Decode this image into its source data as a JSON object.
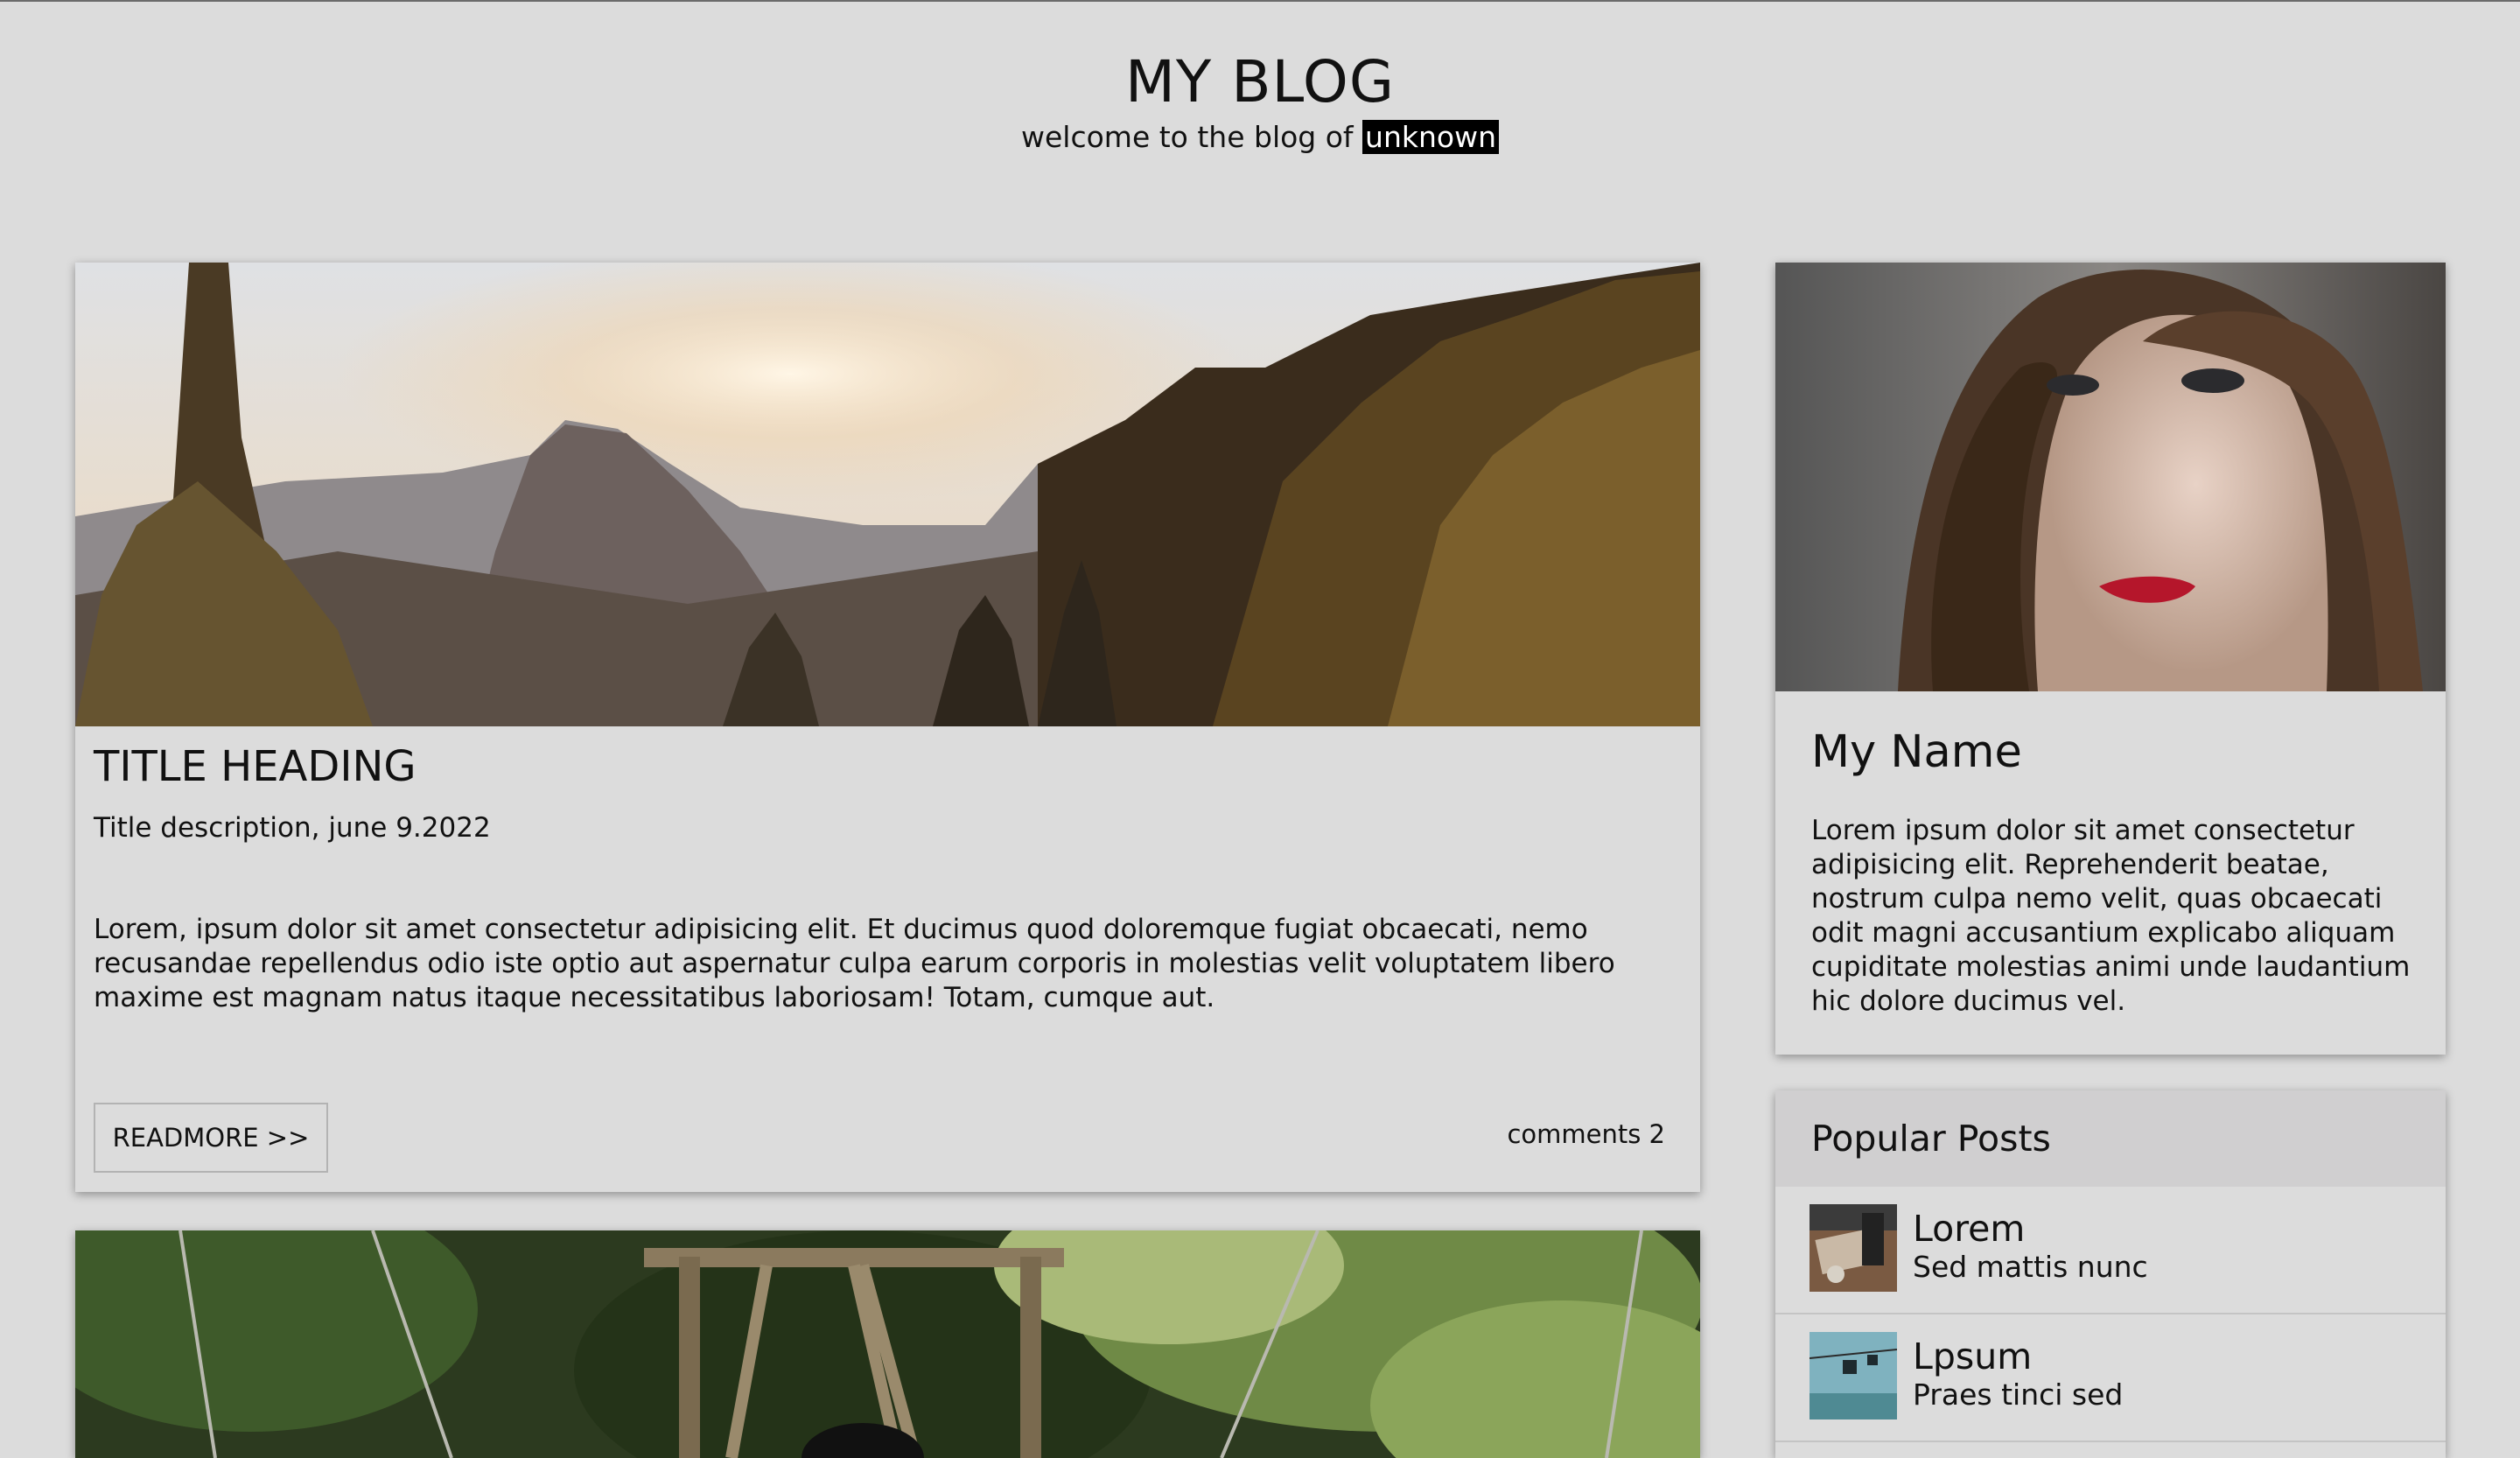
{
  "header": {
    "title": "MY BLOG",
    "subtitle_prefix": "welcome to the blog of ",
    "subtitle_owner": "unknown"
  },
  "posts": [
    {
      "title": "TITLE HEADING",
      "description": "Title description, june 9.2022",
      "body": "Lorem, ipsum dolor sit amet consectetur adipisicing elit. Et ducimus quod doloremque fugiat obcaecati, nemo recusandae repellendus odio iste optio aut aspernatur culpa earum corporis in molestias velit voluptatem libero maxime est magnam natus itaque necessitatibus laboriosam! Totam, cumque aut.",
      "readmore_label": "READMORE >>",
      "comments": "comments 2"
    }
  ],
  "profile": {
    "name": "My Name",
    "bio": "Lorem ipsum dolor sit amet consectetur adipisicing elit. Reprehenderit beatae, nostrum culpa nemo velit, quas obcaecati odit magni accusantium explicabo aliquam cupiditate molestias animi unde laudantium hic dolore ducimus vel."
  },
  "popular": {
    "title": "Popular Posts",
    "items": [
      {
        "title": "Lorem",
        "subtitle": "Sed mattis nunc"
      },
      {
        "title": "Lpsum",
        "subtitle": "Praes tinci sed"
      }
    ]
  }
}
